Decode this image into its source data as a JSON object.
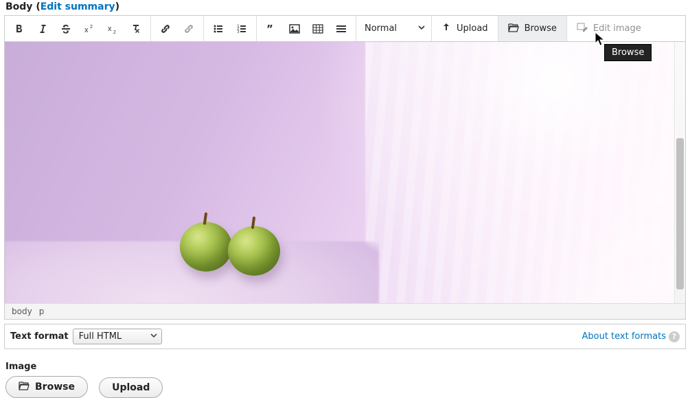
{
  "field": {
    "label": "Body",
    "edit_summary": "Edit summary"
  },
  "toolbar": {
    "style_dropdown": "Normal",
    "upload": "Upload",
    "browse": "Browse",
    "edit_image": "Edit image"
  },
  "tooltip": {
    "browse": "Browse"
  },
  "path": {
    "body": "body",
    "p": "p"
  },
  "format": {
    "label": "Text format",
    "value": "Full HTML",
    "about": "About text formats"
  },
  "image_section": {
    "label": "Image",
    "browse": "Browse",
    "upload": "Upload"
  }
}
